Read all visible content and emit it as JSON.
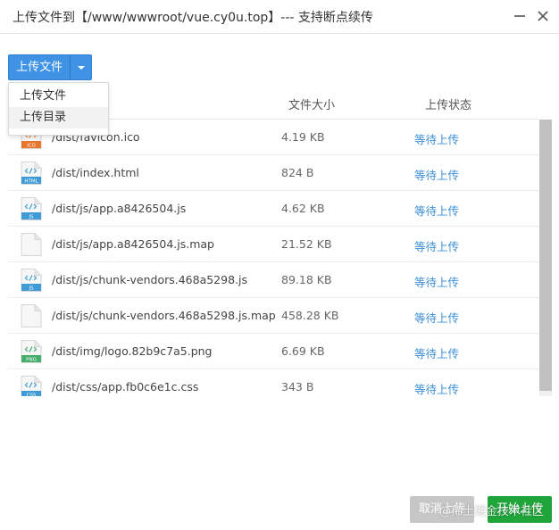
{
  "window": {
    "title": "上传文件到【/www/wwwroot/vue.cy0u.top】--- 支持断点续传"
  },
  "toolbar": {
    "upload_label": "上传文件"
  },
  "dropdown": {
    "items": [
      {
        "label": "上传文件"
      },
      {
        "label": "上传目录"
      }
    ]
  },
  "columns": {
    "size": "文件大小",
    "status": "上传状态"
  },
  "files": [
    {
      "name": "/dist/favicon.ico",
      "size": "4.19 KB",
      "status": "等待上传",
      "icon": "ico-file-icon",
      "icon_text": "ICO",
      "color": "#e8762c"
    },
    {
      "name": "/dist/index.html",
      "size": "824 B",
      "status": "等待上传",
      "icon": "html-file-icon",
      "icon_text": "HTML",
      "color": "#3f9bd6"
    },
    {
      "name": "/dist/js/app.a8426504.js",
      "size": "4.62 KB",
      "status": "等待上传",
      "icon": "js-file-icon",
      "icon_text": "JS",
      "color": "#3f9bd6"
    },
    {
      "name": "/dist/js/app.a8426504.js.map",
      "size": "21.52 KB",
      "status": "等待上传",
      "icon": "generic-file-icon",
      "icon_text": "",
      "color": "#cccccc"
    },
    {
      "name": "/dist/js/chunk-vendors.468a5298.js",
      "size": "89.18 KB",
      "status": "等待上传",
      "icon": "js-file-icon",
      "icon_text": "JS",
      "color": "#3f9bd6"
    },
    {
      "name": "/dist/js/chunk-vendors.468a5298.js.map",
      "size": "458.28 KB",
      "status": "等待上传",
      "icon": "generic-file-icon",
      "icon_text": "",
      "color": "#cccccc"
    },
    {
      "name": "/dist/img/logo.82b9c7a5.png",
      "size": "6.69 KB",
      "status": "等待上传",
      "icon": "png-file-icon",
      "icon_text": "PNG",
      "color": "#46ad6b"
    },
    {
      "name": "/dist/css/app.fb0c6e1c.css",
      "size": "343 B",
      "status": "等待上传",
      "icon": "css-file-icon",
      "icon_text": "CSS",
      "color": "#3f9bd6"
    }
  ],
  "footer": {
    "cancel_label": "取消上传",
    "start_label": "开始上传",
    "watermark": "@稀土掘金技术社区"
  },
  "colors": {
    "accent": "#3f92e4",
    "success": "#20a53a",
    "status_link": "#3e8fd6"
  }
}
